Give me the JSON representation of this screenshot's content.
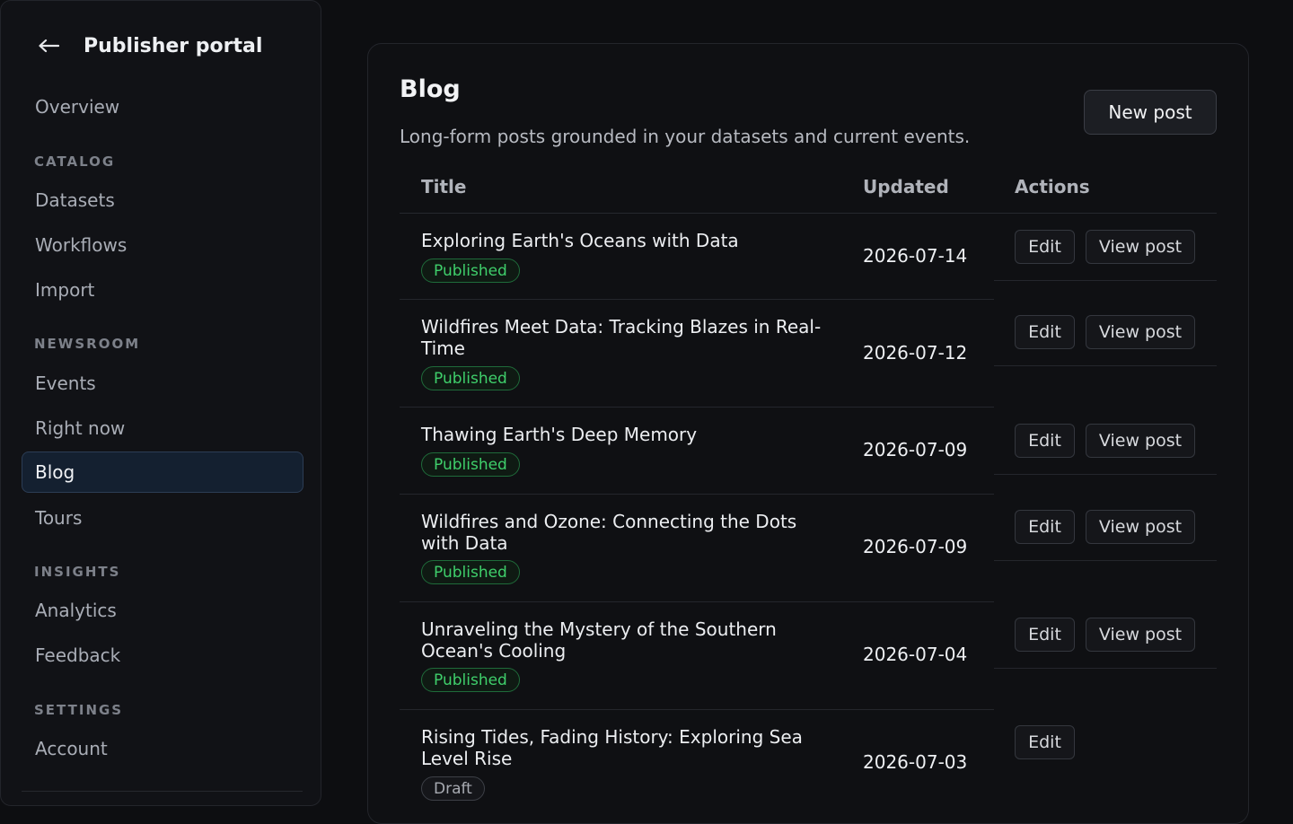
{
  "sidebar": {
    "title": "Publisher portal",
    "back_icon": "arrow-left-icon",
    "overview": "Overview",
    "sections": {
      "catalog": "CATALOG",
      "newsroom": "NEWSROOM",
      "insights": "INSIGHTS",
      "settings": "SETTINGS"
    },
    "items": {
      "datasets": "Datasets",
      "workflows": "Workflows",
      "import": "Import",
      "events": "Events",
      "right_now": "Right now",
      "blog": "Blog",
      "tours": "Tours",
      "analytics": "Analytics",
      "feedback": "Feedback",
      "account": "Account"
    },
    "active": "Blog"
  },
  "main": {
    "title": "Blog",
    "subtitle": "Long-form posts grounded in your datasets and current events.",
    "new_post_label": "New post",
    "columns": {
      "title": "Title",
      "updated": "Updated",
      "actions": "Actions"
    },
    "edit_label": "Edit",
    "view_label": "View post",
    "posts": [
      {
        "title": "Exploring Earth's Oceans with Data",
        "status": "Published",
        "updated": "2026-07-14"
      },
      {
        "title": "Wildfires Meet Data: Tracking Blazes in Real-Time",
        "status": "Published",
        "updated": "2026-07-12"
      },
      {
        "title": "Thawing Earth's Deep Memory",
        "status": "Published",
        "updated": "2026-07-09"
      },
      {
        "title": "Wildfires and Ozone: Connecting the Dots with Data",
        "status": "Published",
        "updated": "2026-07-09"
      },
      {
        "title": "Unraveling the Mystery of the Southern Ocean's Cooling",
        "status": "Published",
        "updated": "2026-07-04"
      },
      {
        "title": "Rising Tides, Fading History: Exploring Sea Level Rise",
        "status": "Draft",
        "updated": "2026-07-03"
      }
    ]
  },
  "colors": {
    "background": "#0d0e11",
    "active_nav": "#142030",
    "published": "#3fcf6b"
  }
}
